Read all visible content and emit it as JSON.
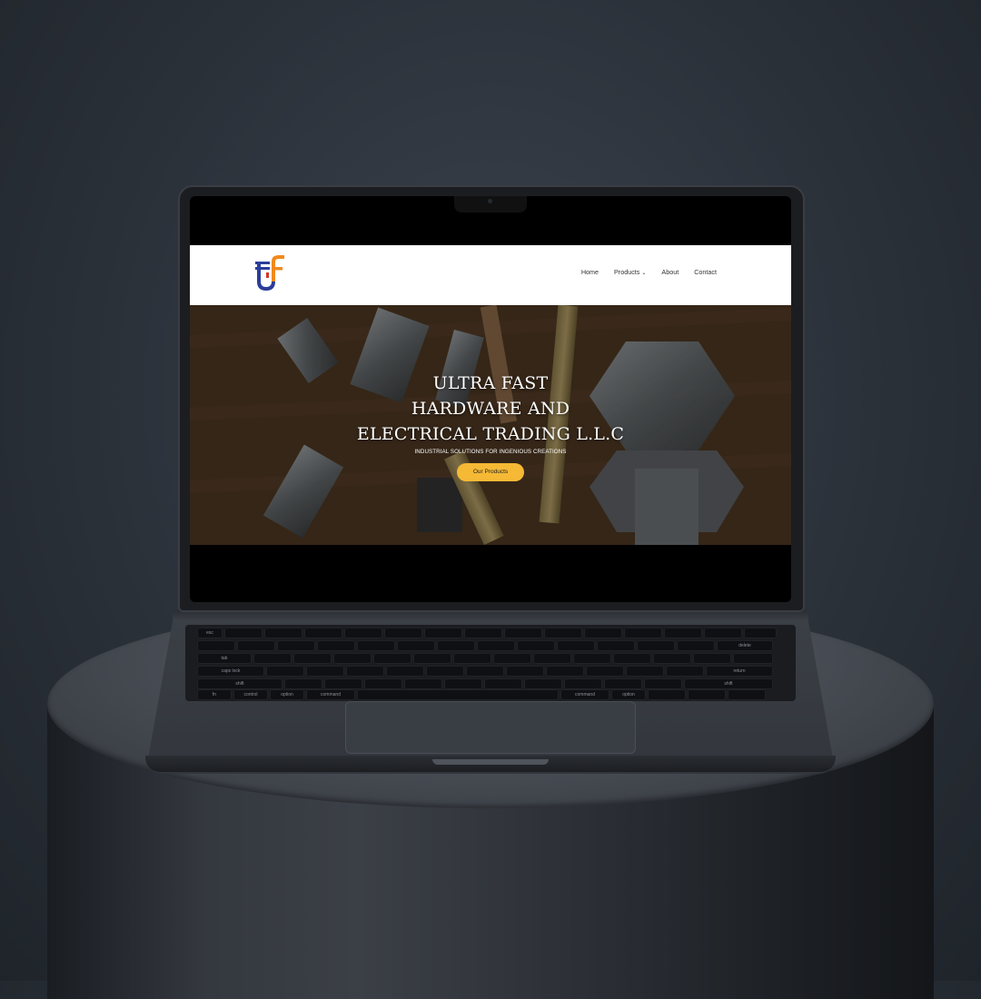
{
  "website": {
    "logo_text": "UF",
    "nav": {
      "items": [
        {
          "label": "Home"
        },
        {
          "label": "Products"
        },
        {
          "label": "About"
        },
        {
          "label": "Contact"
        }
      ]
    },
    "hero": {
      "title_lines": [
        "ULTRA FAST",
        "HARDWARE AND",
        "ELECTRICAL TRADING L.L.C"
      ],
      "subtitle": "INDUSTRIAL SOLUTIONS FOR INGENIOUS CREATIONS",
      "cta_label": "Our Products"
    }
  },
  "keyboard": {
    "labels": [
      "esc",
      "tab",
      "caps lock",
      "shift",
      "fn",
      "control",
      "option",
      "command",
      "command",
      "option",
      "delete",
      "return",
      "shift"
    ]
  },
  "colors": {
    "accent": "#f5b935",
    "logo_blue": "#2b3d9a",
    "logo_orange": "#f08a1c",
    "background": "#2b3139"
  },
  "icons": {
    "chevron": "chevron-down-icon",
    "logo": "uf-logo-icon"
  }
}
